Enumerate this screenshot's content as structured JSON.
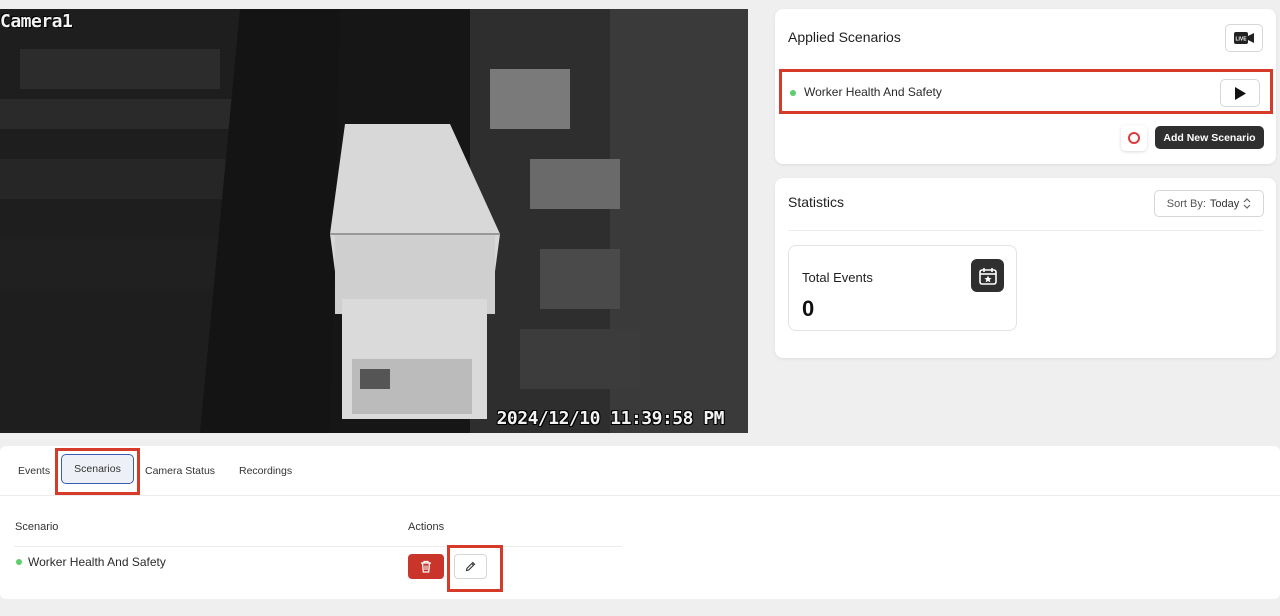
{
  "camera": {
    "name": "Camera1",
    "timestamp": "2024/12/10 11:39:58 PM"
  },
  "applied_scenarios": {
    "title": "Applied Scenarios",
    "live_icon": "live-camera-icon",
    "scenario_name": "Worker Health And Safety",
    "scenario_status_color": "#5ccf6c",
    "add_button_label": "Add New Scenario"
  },
  "statistics": {
    "title": "Statistics",
    "sort_label": "Sort By:",
    "sort_value": "Today",
    "total_events_label": "Total Events",
    "total_events_value": "0",
    "icon": "calendar-star-icon"
  },
  "tabs": {
    "events": "Events",
    "scenarios": "Scenarios",
    "camera_status": "Camera Status",
    "recordings": "Recordings"
  },
  "table": {
    "col_scenario": "Scenario",
    "col_actions": "Actions",
    "rows": [
      {
        "name": "Worker Health And Safety"
      }
    ]
  },
  "colors": {
    "highlight": "#d63b2a",
    "delete": "#c9352a",
    "active_tab_border": "#3b5bb5"
  }
}
